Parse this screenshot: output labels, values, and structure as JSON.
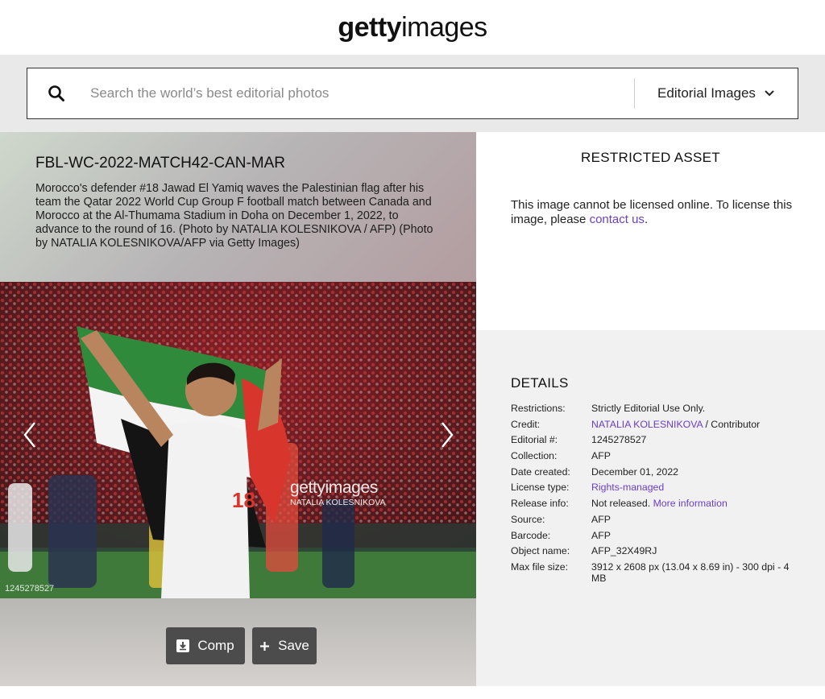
{
  "header": {
    "logo_bold": "getty",
    "logo_light": "images"
  },
  "search": {
    "placeholder": "Search the world’s best editorial photos",
    "type_label": "Editorial Images",
    "icon": "search-icon",
    "dropdown_icon": "chevron-down-icon"
  },
  "asset": {
    "title": "FBL-WC-2022-MATCH42-CAN-MAR",
    "caption": "Morocco's defender #18 Jawad El Yamiq waves the Palestinian flag after his team the Qatar 2022 World Cup Group F football match between Canada and Morocco at the Al-Thumama Stadium in Doha on December 1, 2022, to advance to the round of 16. (Photo by NATALIA KOLESNIKOVA / AFP) (Photo by NATALIA KOLESNIKOVA/AFP via Getty Images)",
    "photo_id": "1245278527",
    "watermark_logo": "gettyimages",
    "watermark_name": "NATALIA KOLESNIKOVA"
  },
  "actions": {
    "comp_label": "Comp",
    "save_label": "Save"
  },
  "restricted": {
    "title": "RESTRICTED ASSET",
    "text": "This image cannot be licensed online. To license this image, please ",
    "link": "contact us",
    "text_end": "."
  },
  "details": {
    "title": "DETAILS",
    "rows": [
      {
        "label": "Restrictions:",
        "value": "Strictly Editorial Use Only."
      },
      {
        "label": "Credit:",
        "link": "NATALIA KOLESNIKOVA",
        "value": " / Contributor"
      },
      {
        "label": "Editorial #:",
        "value": "1245278527"
      },
      {
        "label": "Collection:",
        "value": "AFP"
      },
      {
        "label": "Date created:",
        "value": "December 01, 2022"
      },
      {
        "label": "License type:",
        "link": "Rights-managed",
        "value": ""
      },
      {
        "label": "Release info:",
        "value": "Not released. ",
        "link_after": "More information"
      },
      {
        "label": "Source:",
        "value": "AFP"
      },
      {
        "label": "Barcode:",
        "value": "AFP"
      },
      {
        "label": "Object name:",
        "value": "AFP_32X49RJ"
      },
      {
        "label": "Max file size:",
        "value": "3912 x 2608 px (13.04 x 8.69 in) - 300 dpi - 4 MB"
      }
    ]
  },
  "colors": {
    "link": "#6a3fc8",
    "button": "#4c4c4c",
    "details_bg": "#f1f1f1"
  }
}
